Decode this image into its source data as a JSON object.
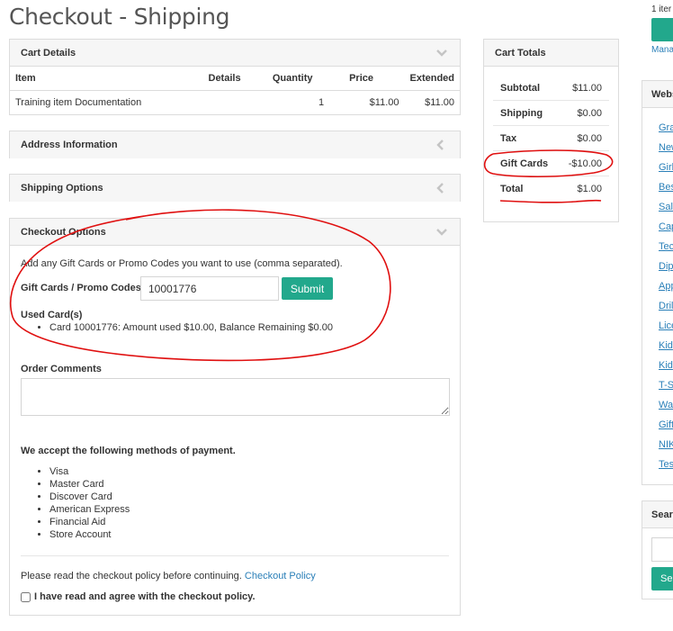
{
  "page": {
    "title": "Checkout - Shipping"
  },
  "cart_details": {
    "header": "Cart Details",
    "columns": {
      "item": "Item",
      "details": "Details",
      "quantity": "Quantity",
      "price": "Price",
      "extended": "Extended"
    },
    "rows": [
      {
        "item": "Training item Documentation",
        "details": "",
        "quantity": "1",
        "price": "$11.00",
        "extended": "$11.00"
      }
    ]
  },
  "address": {
    "header": "Address Information"
  },
  "shipping_options": {
    "header": "Shipping Options"
  },
  "checkout_options": {
    "header": "Checkout Options",
    "instructions": "Add any Gift Cards or Promo Codes you want to use (comma separated).",
    "code_label": "Gift Cards / Promo Codes",
    "code_value": "10001776",
    "submit_label": "Submit",
    "used_cards_label": "Used Card(s)",
    "used_cards": [
      "Card 10001776: Amount used $10.00, Balance Remaining $0.00"
    ],
    "order_comments_label": "Order Comments",
    "payment_heading": "We accept the following methods of payment.",
    "payment_methods": [
      "Visa",
      "Master Card",
      "Discover Card",
      "American Express",
      "Financial Aid",
      "Store Account"
    ],
    "policy_text": "Please read the checkout policy before continuing.",
    "policy_link": "Checkout Policy",
    "agree_label": "I have read and agree with the checkout policy."
  },
  "cart_totals": {
    "header": "Cart Totals",
    "subtotal_label": "Subtotal",
    "subtotal": "$11.00",
    "shipping_label": "Shipping",
    "shipping": "$0.00",
    "tax_label": "Tax",
    "tax": "$0.00",
    "giftcards_label": "Gift Cards",
    "giftcards": "-$10.00",
    "total_label": "Total",
    "total": "$1.00"
  },
  "right_column": {
    "item_count": "1 iter",
    "manage_link": "Mana",
    "websites_header": "Webs",
    "links": [
      "Gra",
      "New",
      "Girl",
      "Bes",
      "Sale",
      "Cap",
      "Tec",
      "Dip",
      "App",
      "Dril",
      "Lice",
      "Kid",
      "Kid",
      "T-S",
      "Wa",
      "Gift",
      "NIK",
      "Tes"
    ],
    "search_header": "Sear",
    "search_button": "Se"
  },
  "colors": {
    "accent": "#22a88c",
    "link": "#2a7fb8",
    "annotation": "#e01010"
  }
}
